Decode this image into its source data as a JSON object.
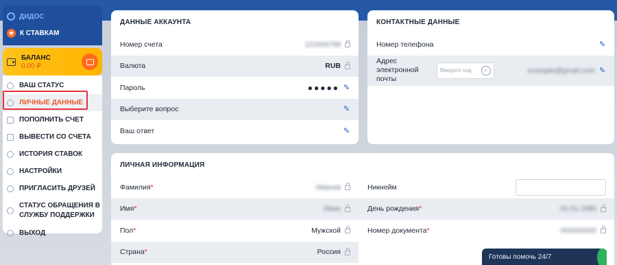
{
  "sidebar": {
    "brand": "ДИДОС",
    "back": "К СТАВКАМ",
    "balance": {
      "label": "БАЛАНС",
      "amount": "0,00 ₽"
    },
    "menu": [
      {
        "label": "ВАШ СТАТУС",
        "icon": "gear-icon"
      },
      {
        "label": "ЛИЧНЫЕ ДАННЫЕ",
        "icon": "user-icon"
      },
      {
        "label": "ПОПОЛНИТЬ СЧЕТ",
        "icon": "wallet-icon"
      },
      {
        "label": "ВЫВЕСТИ СО СЧЕТА",
        "icon": "withdraw-icon"
      },
      {
        "label": "ИСТОРИЯ СТАВОК",
        "icon": "clock-icon"
      },
      {
        "label": "НАСТРОЙКИ",
        "icon": "settings-icon"
      },
      {
        "label": "ПРИГЛАСИТЬ ДРУЗЕЙ",
        "icon": "friends-icon"
      },
      {
        "label": "СТАТУС ОБРАЩЕНИЯ В СЛУЖБУ ПОДДЕРЖКИ",
        "icon": "support-icon"
      },
      {
        "label": "ВЫХОД",
        "icon": "logout-icon"
      }
    ]
  },
  "account": {
    "title": "ДАННЫЕ АККАУНТА",
    "rows": [
      {
        "key": "Номер счета",
        "value": "123456789"
      },
      {
        "key": "Валюта",
        "value": "RUB"
      },
      {
        "key": "Пароль",
        "value": "●●●●●"
      },
      {
        "key": "Выберите вопрос",
        "value": ""
      },
      {
        "key": "Ваш ответ",
        "value": ""
      }
    ]
  },
  "contacts": {
    "title": "КОНТАКТНЫЕ ДАННЫЕ",
    "phone_label": "Номер телефона",
    "email_label": "Адрес электронной почты",
    "code_placeholder": "Введите код",
    "email_value": "example@gmail.com"
  },
  "personal": {
    "title": "ЛИЧНАЯ ИНФОРМАЦИЯ",
    "left": [
      {
        "key": "Фамилия",
        "value": "Иванов"
      },
      {
        "key": "Имя",
        "value": "Иван"
      },
      {
        "key": "Пол",
        "value": "Мужской"
      },
      {
        "key": "Страна",
        "value": "Россия"
      }
    ],
    "right": [
      {
        "key": "Никнейм",
        "value": ""
      },
      {
        "key": "День рождения",
        "value": "01.01.1990"
      },
      {
        "key": "Номер документа",
        "value": "000000000"
      }
    ]
  },
  "chat": {
    "label": "Готовы помочь 24/7"
  },
  "colors": {
    "accent": "#ea5a2a",
    "brand": "#1f4f9c",
    "balance": "#ffb400"
  }
}
